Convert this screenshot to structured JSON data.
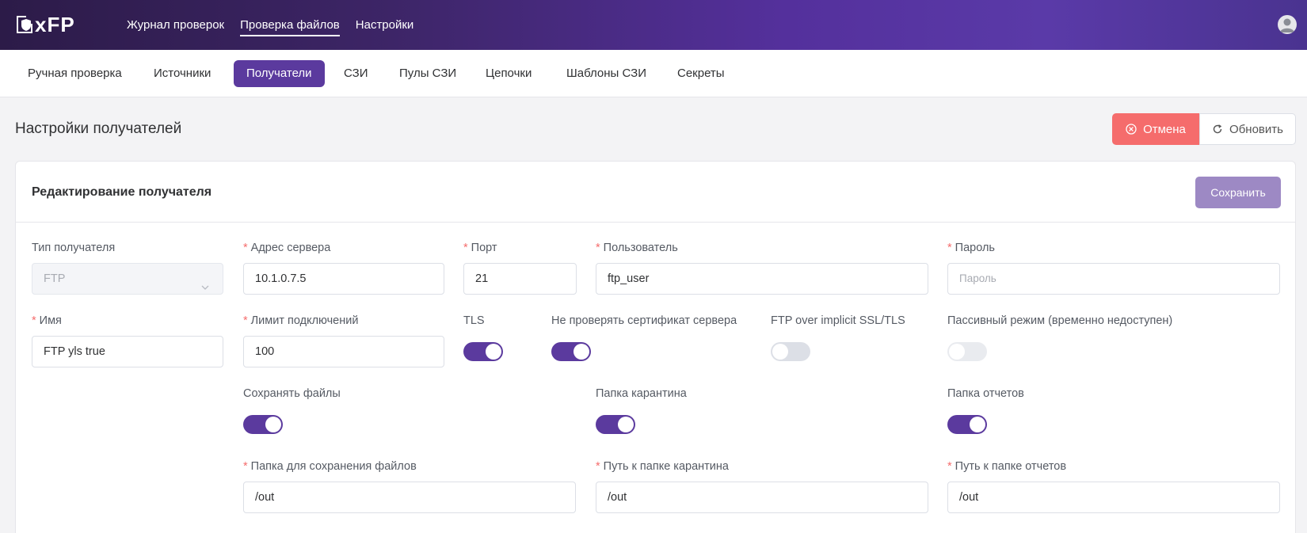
{
  "app": {
    "logo_text": "xFP"
  },
  "topnav": [
    {
      "label": "Журнал проверок",
      "active": false
    },
    {
      "label": "Проверка файлов",
      "active": true
    },
    {
      "label": "Настройки",
      "active": false
    }
  ],
  "subnav": [
    {
      "label": "Ручная проверка",
      "active": false
    },
    {
      "label": "Источники",
      "active": false
    },
    {
      "label": "Получатели",
      "active": true
    },
    {
      "label": "СЗИ",
      "active": false
    },
    {
      "label": "Пулы СЗИ",
      "active": false
    },
    {
      "label": "Цепочки",
      "active": false
    },
    {
      "label": "Шаблоны СЗИ",
      "active": false
    },
    {
      "label": "Секреты",
      "active": false
    }
  ],
  "page": {
    "title": "Настройки получателей",
    "cancel_label": "Отмена",
    "refresh_label": "Обновить"
  },
  "card": {
    "title": "Редактирование получателя",
    "save_label": "Сохранить"
  },
  "form": {
    "type": {
      "label": "Тип получателя",
      "value": "FTP"
    },
    "server": {
      "label": "Адрес сервера",
      "value": "10.1.0.7.5",
      "required": true
    },
    "port": {
      "label": "Порт",
      "value": "21",
      "required": true
    },
    "user": {
      "label": "Пользователь",
      "value": "ftp_user",
      "required": true
    },
    "password": {
      "label": "Пароль",
      "placeholder": "Пароль",
      "required": true
    },
    "name": {
      "label": "Имя",
      "value": "FTP yls true",
      "required": true
    },
    "limit": {
      "label": "Лимит подключений",
      "value": "100",
      "required": true
    },
    "tls": {
      "label": "TLS",
      "on": true
    },
    "no_verify": {
      "label": "Не проверять сертификат сервера",
      "on": true
    },
    "implicit": {
      "label": "FTP over implicit SSL/TLS",
      "on": false
    },
    "passive": {
      "label": "Пассивный режим (временно недоступен)",
      "on": false,
      "disabled": true
    },
    "save_files": {
      "label": "Сохранять файлы",
      "on": true
    },
    "quarantine": {
      "label": "Папка карантина",
      "on": true
    },
    "reports": {
      "label": "Папка отчетов",
      "on": true
    },
    "save_path": {
      "label": "Папка для сохранения файлов",
      "value": "/out",
      "required": true
    },
    "quarantine_path": {
      "label": "Путь к папке карантина",
      "value": "/out",
      "required": true
    },
    "reports_path": {
      "label": "Путь к папке отчетов",
      "value": "/out",
      "required": true
    }
  },
  "colors": {
    "accent": "#5b3a9e",
    "danger": "#f56c6c",
    "save_disabled": "#9d89c4"
  }
}
